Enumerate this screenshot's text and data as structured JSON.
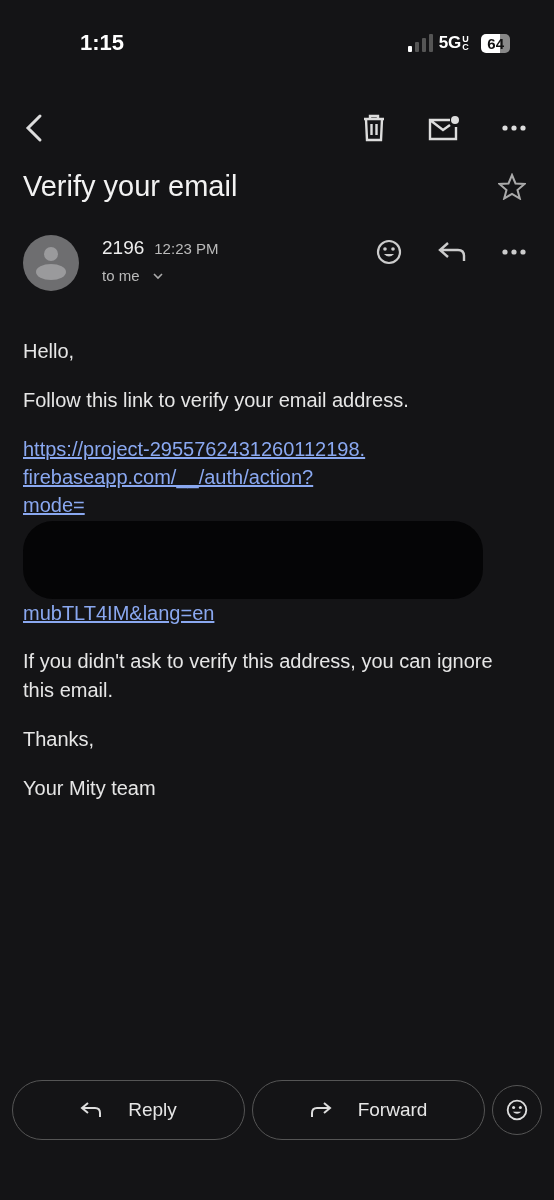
{
  "status_bar": {
    "time": "1:15",
    "network": "5G",
    "network_suffix": "UC",
    "battery": "64"
  },
  "message": {
    "subject": "Verify your email",
    "starred": false,
    "sender": "2196",
    "time": "12:23 PM",
    "recipient": "to me"
  },
  "body": {
    "greeting": "Hello,",
    "intro": "Follow this link to verify your email address.",
    "link_lines": [
      "https://project-2955762431260112198.",
      "firebaseapp.com/__/auth/action?",
      "mode="
    ],
    "link_tail": "mubTLT4IM&lang=en",
    "note": "If you didn't ask to verify this address, you can ignore this email.",
    "closing": "Thanks,",
    "signature": "Your Mity team"
  },
  "actions": [
    {
      "kind": "reply",
      "label": "Reply"
    },
    {
      "kind": "forward",
      "label": "Forward"
    }
  ]
}
